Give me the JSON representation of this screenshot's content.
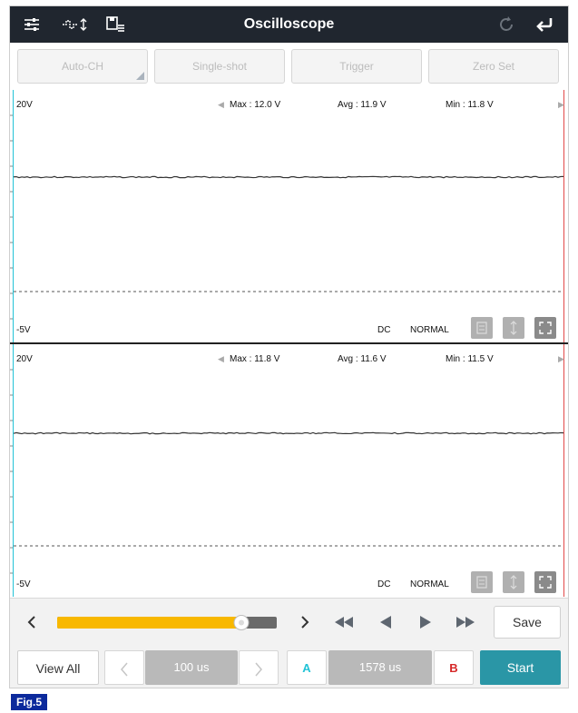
{
  "header": {
    "title": "Oscilloscope",
    "icons": [
      "settings-sliders-icon",
      "waveform-icon",
      "save-list-icon",
      "refresh-icon",
      "back-icon"
    ]
  },
  "modes": [
    {
      "label": "Auto-CH"
    },
    {
      "label": "Single-shot"
    },
    {
      "label": "Trigger"
    },
    {
      "label": "Zero Set"
    }
  ],
  "channels": [
    {
      "top_label": "20V",
      "max": "Max : 12.0 V",
      "avg": "Avg : 11.9 V",
      "min": "Min : 11.8 V",
      "bottom_label": "-5V",
      "coupling": "DC",
      "mode": "NORMAL"
    },
    {
      "top_label": "20V",
      "max": "Max : 11.8 V",
      "avg": "Avg : 11.6 V",
      "min": "Min : 11.5 V",
      "bottom_label": "-5V",
      "coupling": "DC",
      "mode": "NORMAL"
    }
  ],
  "playback": {
    "save_label": "Save",
    "slider_fraction": 0.87
  },
  "bottom": {
    "view_all": "View All",
    "time_per_div": "100 us",
    "cursor_a": "A",
    "cursor_delta": "1578 us",
    "cursor_b": "B",
    "start": "Start"
  },
  "figure_label": "Fig.5",
  "colors": {
    "header_bg": "#20262f",
    "start_button": "#2a96a6",
    "cursor_a": "#22c3d6",
    "cursor_b": "#d62828",
    "slider_fill": "#f8b800",
    "figure_badge": "#0c2a9c"
  }
}
